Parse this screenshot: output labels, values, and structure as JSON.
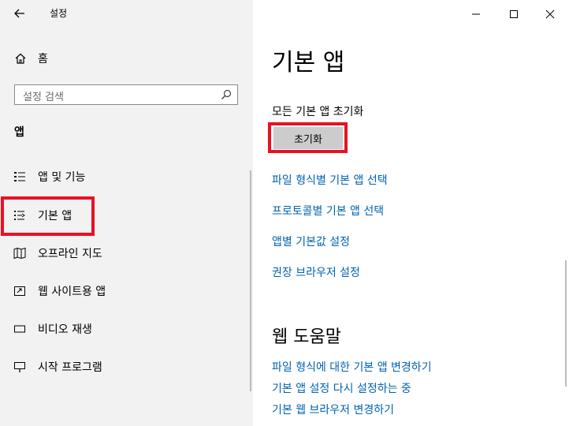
{
  "window": {
    "title": "설정"
  },
  "sidebar": {
    "home_label": "홈",
    "search_placeholder": "설정 검색",
    "section_label": "앱",
    "items": [
      {
        "label": "앱 및 기능",
        "icon": "apps-list-icon"
      },
      {
        "label": "기본 앱",
        "icon": "default-apps-icon",
        "selected": true
      },
      {
        "label": "오프라인 지도",
        "icon": "map-icon"
      },
      {
        "label": "웹 사이트용 앱",
        "icon": "web-app-icon"
      },
      {
        "label": "비디오 재생",
        "icon": "video-icon"
      },
      {
        "label": "시작 프로그램",
        "icon": "startup-icon"
      }
    ]
  },
  "main": {
    "title": "기본 앱",
    "reset_heading": "모든 기본 앱 초기화",
    "reset_button": "초기화",
    "links": [
      "파일 형식별 기본 앱 선택",
      "프로토콜별 기본 앱 선택",
      "앱별 기본값 설정",
      "권장 브라우저 설정"
    ],
    "web_help_title": "웹 도움말",
    "web_help_links": [
      "파일 형식에 대한 기본 앱 변경하기",
      "기본 앱 설정 다시 설정하는 중",
      "기본 웹 브라우저 변경하기"
    ]
  },
  "colors": {
    "accent_link": "#0063b1",
    "highlight": "#e81123",
    "sidebar_bg": "#f2f2f2",
    "button_bg": "#cccccc"
  }
}
